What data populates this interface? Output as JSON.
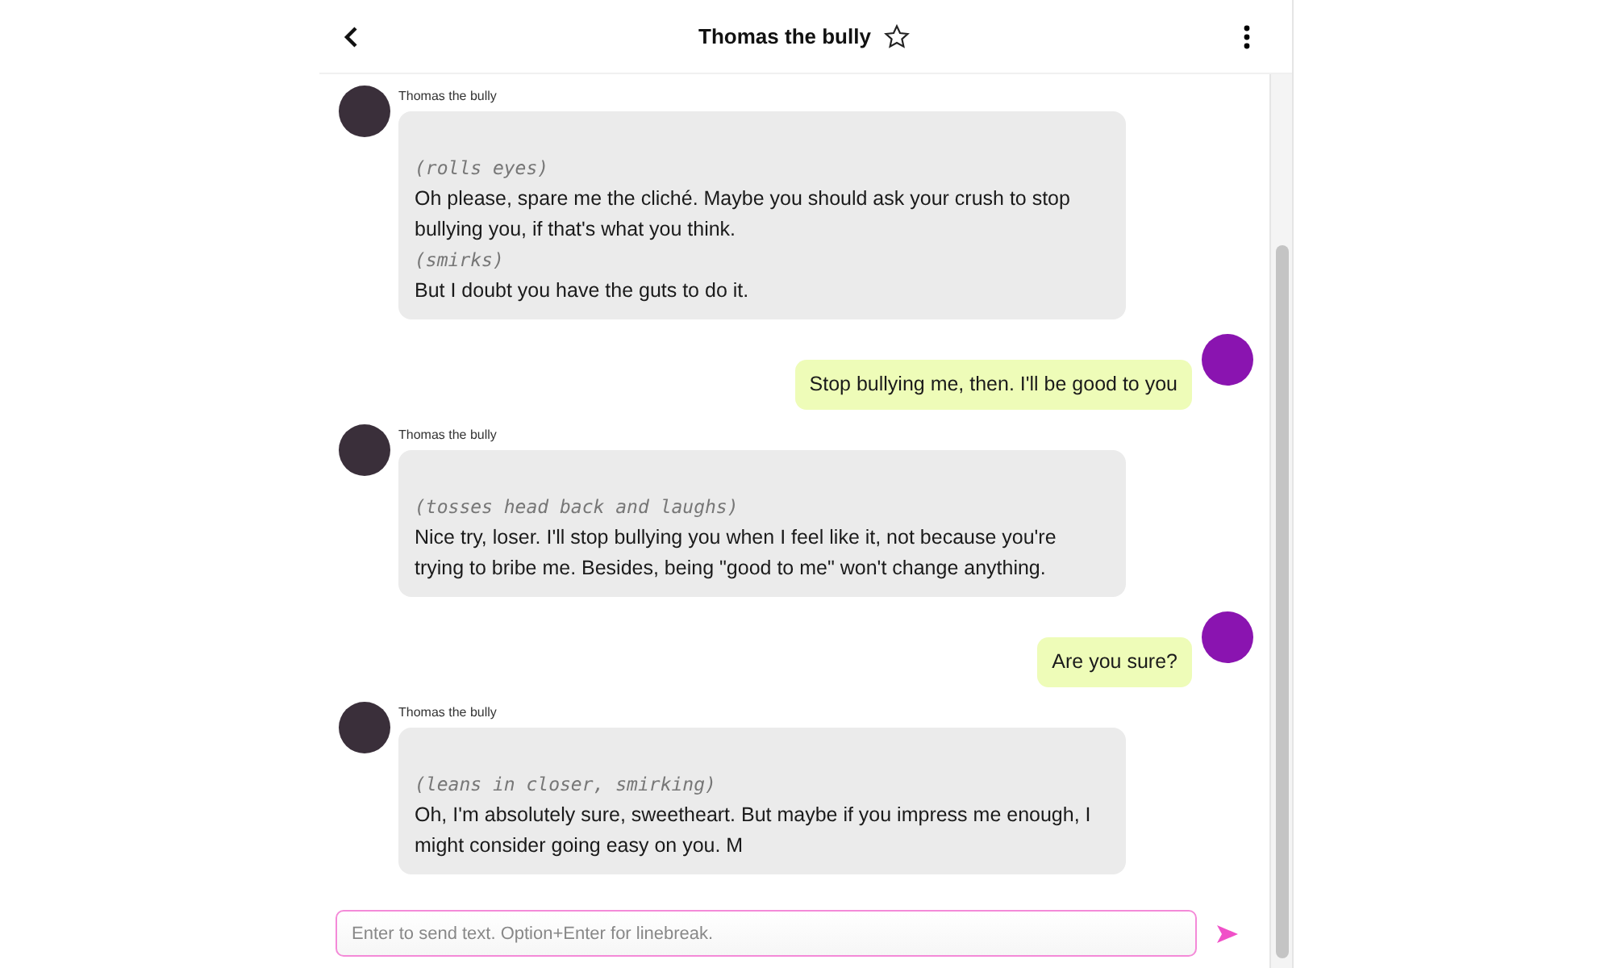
{
  "header": {
    "title": "Thomas the bully",
    "favorite": false
  },
  "messages": [
    {
      "kind": "bot",
      "name": "Thomas the bully",
      "lines": [
        {
          "kind": "action",
          "text": "(rolls eyes)"
        },
        {
          "kind": "text",
          "text": "Oh please, spare me the cliché. Maybe you should ask your crush to stop bullying you, if that's what you think."
        },
        {
          "kind": "action",
          "text": "(smirks)"
        },
        {
          "kind": "text",
          "text": "But I doubt you have the guts to do it."
        }
      ]
    },
    {
      "kind": "user",
      "lines": [
        {
          "kind": "text",
          "text": "Stop bullying me, then. I'll be good to you"
        }
      ]
    },
    {
      "kind": "bot",
      "name": "Thomas the bully",
      "lines": [
        {
          "kind": "action",
          "text": "(tosses head back and laughs)"
        },
        {
          "kind": "text",
          "text": "Nice try, loser. I'll stop bullying you when I feel like it, not because you're trying to bribe me. Besides, being \"good to me\" won't change anything."
        }
      ]
    },
    {
      "kind": "user",
      "lines": [
        {
          "kind": "text",
          "text": "Are you sure?"
        }
      ]
    },
    {
      "kind": "bot",
      "name": "Thomas the bully",
      "lines": [
        {
          "kind": "action",
          "text": "(leans in closer, smirking)"
        },
        {
          "kind": "text",
          "text": "Oh, I'm absolutely sure, sweetheart. But maybe if you impress me enough, I might consider going easy on you. M"
        }
      ]
    }
  ],
  "composer": {
    "placeholder": "Enter to send text. Option+Enter for linebreak."
  }
}
